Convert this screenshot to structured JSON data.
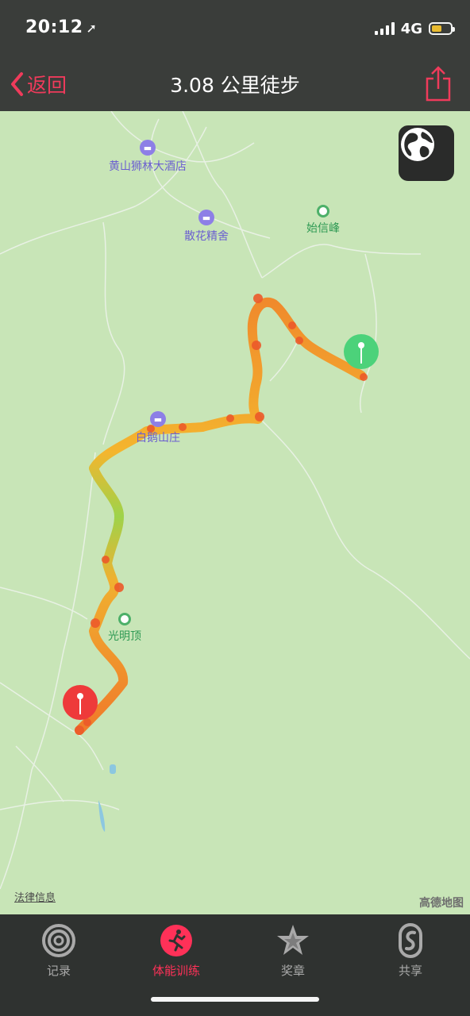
{
  "status": {
    "time": "20:12",
    "network": "4G"
  },
  "nav": {
    "back": "返回",
    "title": "3.08 公里徒步"
  },
  "map": {
    "pois": [
      {
        "name": "黄山狮林大酒店",
        "type": "hotel"
      },
      {
        "name": "散花精舍",
        "type": "hotel"
      },
      {
        "name": "始信峰",
        "type": "peak"
      },
      {
        "name": "白鹅山庄",
        "type": "hotel"
      },
      {
        "name": "光明顶",
        "type": "peak"
      }
    ],
    "legal": "法律信息",
    "provider": "高德地图"
  },
  "tabs": [
    {
      "label": "记录",
      "icon": "activity-rings-icon"
    },
    {
      "label": "体能训练",
      "icon": "running-figure-icon"
    },
    {
      "label": "奖章",
      "icon": "star-award-icon"
    },
    {
      "label": "共享",
      "icon": "sharing-icon"
    }
  ],
  "colors": {
    "accent": "#ff3158",
    "route_start": "#4cd27a",
    "route_end": "#ee3a3a",
    "map_bg": "#c8e5b7"
  }
}
